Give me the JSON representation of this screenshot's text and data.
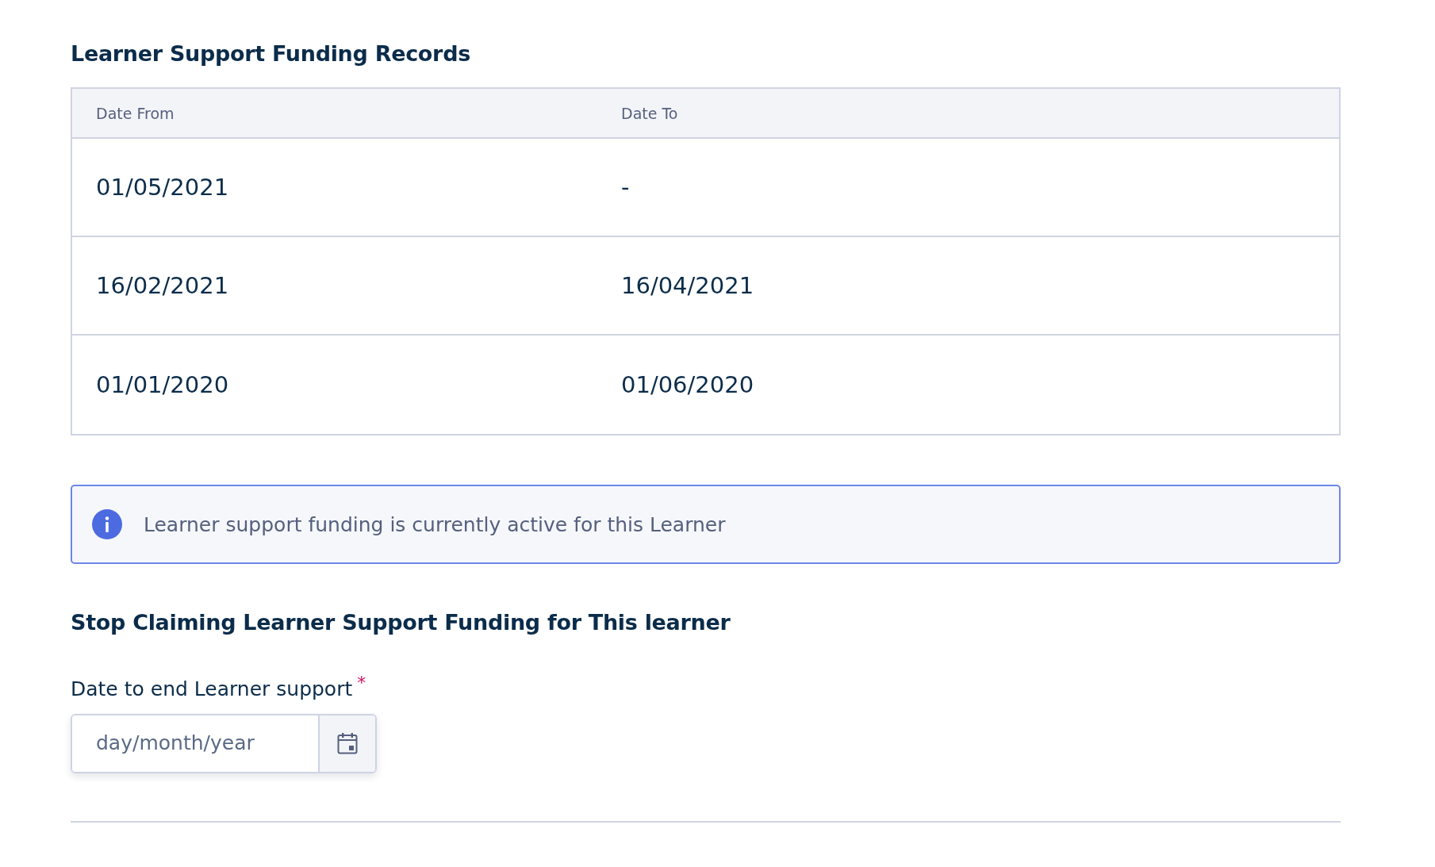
{
  "records": {
    "title": "Learner Support Funding Records",
    "columns": [
      "Date From",
      "Date To"
    ],
    "rows": [
      [
        "01/05/2021",
        "-"
      ],
      [
        "16/02/2021",
        "16/04/2021"
      ],
      [
        "01/01/2020",
        "01/06/2020"
      ]
    ]
  },
  "info_alert": {
    "text": "Learner support funding is currently active for this Learner"
  },
  "stop_section": {
    "title": "Stop Claiming Learner Support Funding for This learner",
    "field": {
      "label": "Date to end Learner support",
      "required_mark": "*",
      "placeholder": "day/month/year"
    }
  }
}
